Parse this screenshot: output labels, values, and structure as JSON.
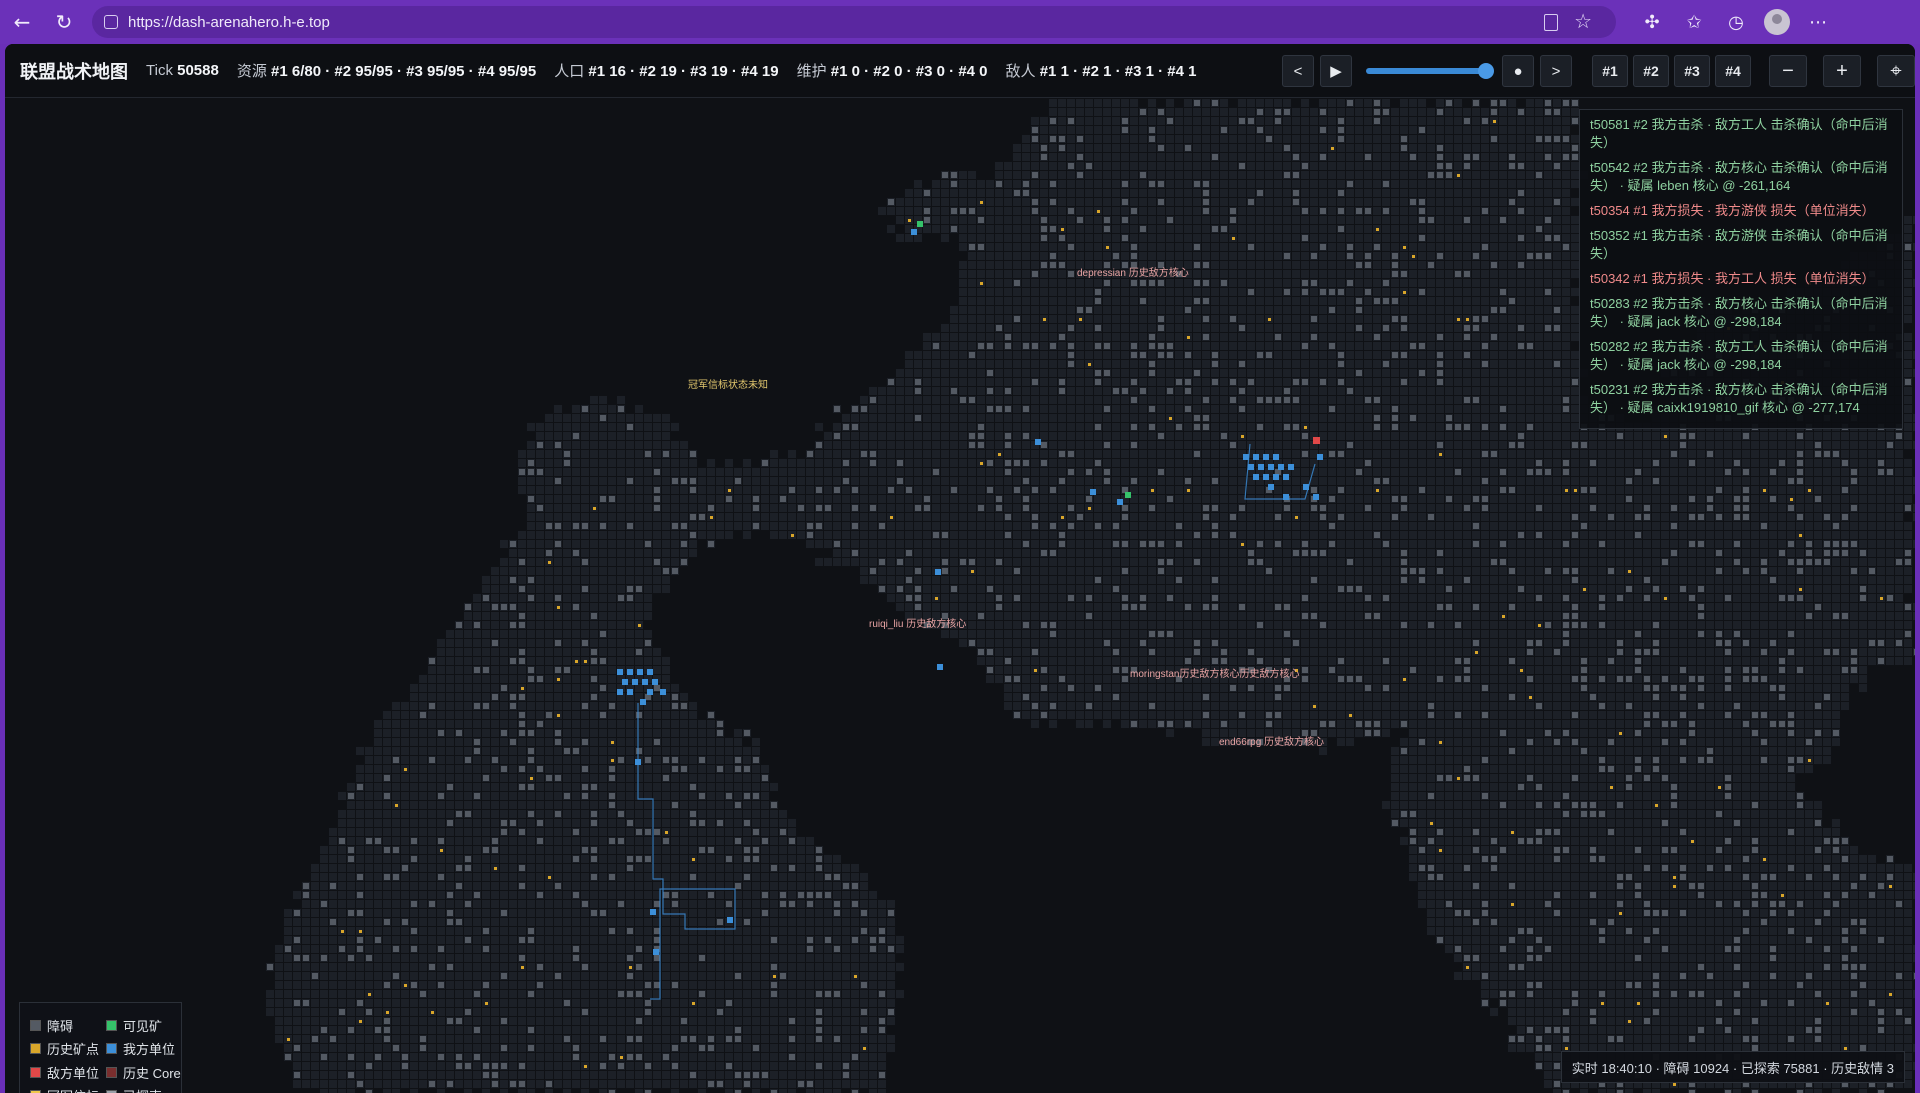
{
  "browser": {
    "url": "https://dash-arenahero.h-e.top"
  },
  "header": {
    "title": "联盟战术地图",
    "tick_label": "Tick",
    "tick_value": "50588",
    "resources_label": "资源",
    "resources_value": "#1 6/80 · #2 95/95 · #3 95/95 · #4 95/95",
    "population_label": "人口",
    "population_value": "#1 16 · #2 19 · #3 19 · #4 19",
    "upkeep_label": "维护",
    "upkeep_value": "#1 0 · #2 0 · #3 0 · #4 0",
    "enemies_label": "敌人",
    "enemies_value": "#1 1 · #2 1 · #3 1 · #4 1"
  },
  "controls": {
    "prev": "<",
    "play": "▶",
    "progress": 1.0,
    "live": "●",
    "next": ">",
    "teams": [
      "#1",
      "#2",
      "#3",
      "#4"
    ],
    "zoom_out": "−",
    "zoom_in": "+",
    "locate": "⌖"
  },
  "map": {
    "labels": {
      "depressian": "depressian 历史敌方核心",
      "beacon": "冠军信标状态未知",
      "ruiqi": "ruiqi_liu 历史敌方核心",
      "moringstan": "moringstan历史敌方核心历史敌方核心",
      "end66rpg": "end66rpg 历史敌方核心"
    },
    "colors": {
      "background": "#0f1115",
      "explored": "#1c2027",
      "grid": "#262b33",
      "obstacle": "#545a63",
      "historic_mine": "#d9a62a",
      "visible_mine": "#35c26a",
      "friendly": "#3c8fd9",
      "enemy": "#e04848",
      "beacon": "#f0c94a"
    }
  },
  "log": [
    {
      "type": "kill",
      "text": "t50581 #2 我方击杀 · 敌方工人 击杀确认（命中后消失）"
    },
    {
      "type": "kill",
      "text": "t50542 #2 我方击杀 · 敌方核心 击杀确认（命中后消失） · 疑属 leben 核心 @ -261,164"
    },
    {
      "type": "loss",
      "text": "t50354 #1 我方损失 · 我方游侠 损失（单位消失）"
    },
    {
      "type": "kill",
      "text": "t50352 #1 我方击杀 · 敌方游侠 击杀确认（命中后消失）"
    },
    {
      "type": "loss",
      "text": "t50342 #1 我方损失 · 我方工人 损失（单位消失）"
    },
    {
      "type": "kill",
      "text": "t50283 #2 我方击杀 · 敌方核心 击杀确认（命中后消失） · 疑属 jack 核心 @ -298,184"
    },
    {
      "type": "kill",
      "text": "t50282 #2 我方击杀 · 敌方工人 击杀确认（命中后消失） · 疑属 jack 核心 @ -298,184"
    },
    {
      "type": "kill",
      "text": "t50231 #2 我方击杀 · 敌方核心 击杀确认（命中后消失） · 疑属 caixk1919810_gif 核心 @ -277,174"
    }
  ],
  "legend": [
    {
      "label": "障碍",
      "color": "#545a63"
    },
    {
      "label": "可见矿",
      "color": "#35c26a"
    },
    {
      "label": "历史矿点",
      "color": "#d9a62a"
    },
    {
      "label": "我方单位",
      "color": "#3c8fd9"
    },
    {
      "label": "敌方单位",
      "color": "#e04848"
    },
    {
      "label": "历史 Core",
      "color": "#7a2e2e"
    },
    {
      "label": "冠军信标",
      "color": "#f0c94a"
    },
    {
      "label": "已探索",
      "color": "#9aa0a8"
    }
  ],
  "status": {
    "text": "实时 18:40:10 · 障碍 10924 · 已探索 75881 · 历史敌情 3"
  }
}
